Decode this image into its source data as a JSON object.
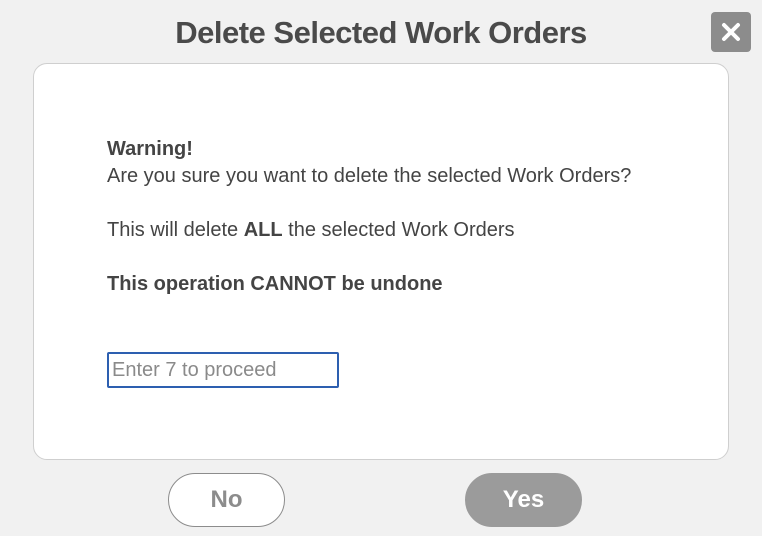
{
  "dialog": {
    "title": "Delete Selected Work Orders",
    "close_icon": "close-x-icon"
  },
  "message": {
    "warning_heading": "Warning!",
    "question": "Are you sure you want to delete the selected Work Orders?",
    "delete_all_prefix": "This will delete ",
    "delete_all_emphasis": "ALL",
    "delete_all_suffix": " the selected Work Orders",
    "cannot_undo": "This operation CANNOT be undone"
  },
  "confirm_input": {
    "placeholder": "Enter 7 to proceed",
    "value": ""
  },
  "buttons": {
    "no_label": "No",
    "yes_label": "Yes"
  },
  "colors": {
    "background": "#f1f1f1",
    "panel": "#ffffff",
    "input_border": "#2d5fb0",
    "close_button": "#8c8c8c",
    "yes_button": "#9b9b9b"
  }
}
